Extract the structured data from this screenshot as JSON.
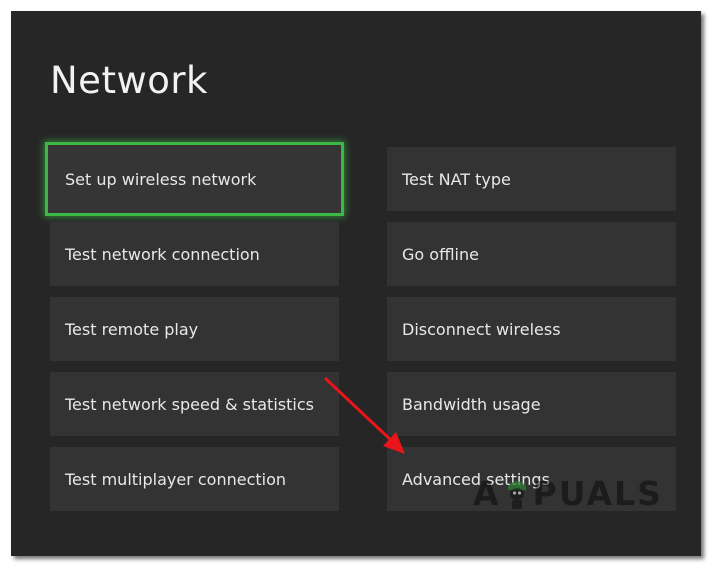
{
  "page": {
    "title": "Network"
  },
  "menu": {
    "left": [
      {
        "label": "Set up wireless network",
        "focused": true
      },
      {
        "label": "Test network connection"
      },
      {
        "label": "Test remote play"
      },
      {
        "label": "Test network speed & statistics"
      },
      {
        "label": "Test multiplayer connection"
      }
    ],
    "right": [
      {
        "label": "Test NAT type"
      },
      {
        "label": "Go offline"
      },
      {
        "label": "Disconnect wireless"
      },
      {
        "label": "Bandwidth usage"
      },
      {
        "label": "Advanced settings"
      }
    ]
  },
  "watermark": {
    "text_before": "A",
    "text_after": "PUALS"
  },
  "colors": {
    "background": "#262626",
    "tile": "#333333",
    "focus": "#3cb846",
    "arrow": "#e8151b"
  }
}
